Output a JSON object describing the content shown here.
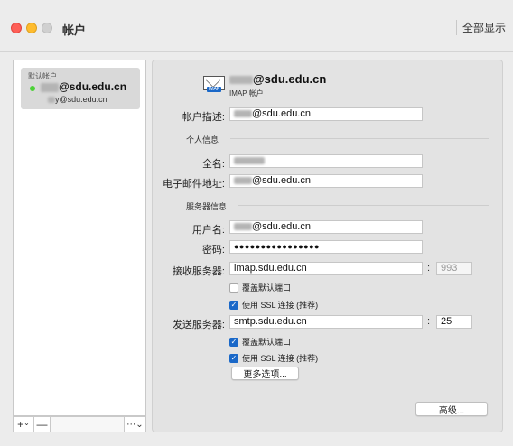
{
  "window": {
    "title": "帐户",
    "show_all": "全部显示",
    "controls": [
      "–",
      "□",
      "×"
    ]
  },
  "sidebar": {
    "group_label": "默认帐户",
    "account_name": "@sdu.edu.cn",
    "account_email": "y@sdu.edu.cn",
    "status_color": "#4cd137",
    "add_label": "+",
    "add_chevron": "⌄",
    "remove_label": "—",
    "action_label": "⋯⌄"
  },
  "header": {
    "email": "@sdu.edu.cn",
    "type": "IMAP 帐户",
    "icon": "mail-icon",
    "badge": "IMAP"
  },
  "form": {
    "description_label": "帐户描述:",
    "description_value": "@sdu.edu.cn",
    "personal_section": "个人信息",
    "fullname_label": "全名:",
    "fullname_value": "",
    "email_label": "电子邮件地址:",
    "email_value": "@sdu.edu.cn",
    "server_section": "服务器信息",
    "username_label": "用户名:",
    "username_value": "@sdu.edu.cn",
    "password_label": "密码:",
    "password_value": "●●●●●●●●●●●●●●●●",
    "incoming_label": "接收服务器:",
    "incoming_value": "imap.sdu.edu.cn",
    "incoming_port": "993",
    "incoming_override_label": "覆盖默认端口",
    "incoming_override_checked": false,
    "incoming_ssl_label": "使用 SSL 连接 (推荐)",
    "incoming_ssl_checked": true,
    "outgoing_label": "发送服务器:",
    "outgoing_value": "smtp.sdu.edu.cn",
    "outgoing_port": "25",
    "outgoing_override_label": "覆盖默认端口",
    "outgoing_override_checked": true,
    "outgoing_ssl_label": "使用 SSL 连接 (推荐)",
    "outgoing_ssl_checked": true,
    "more_options_label": "更多选项...",
    "advanced_label": "高级...",
    "colon": ":",
    "check_mark": "✓"
  },
  "colors": {
    "accent": "#1a68c8",
    "close": "#fe5f57",
    "minimize": "#febc2e"
  }
}
